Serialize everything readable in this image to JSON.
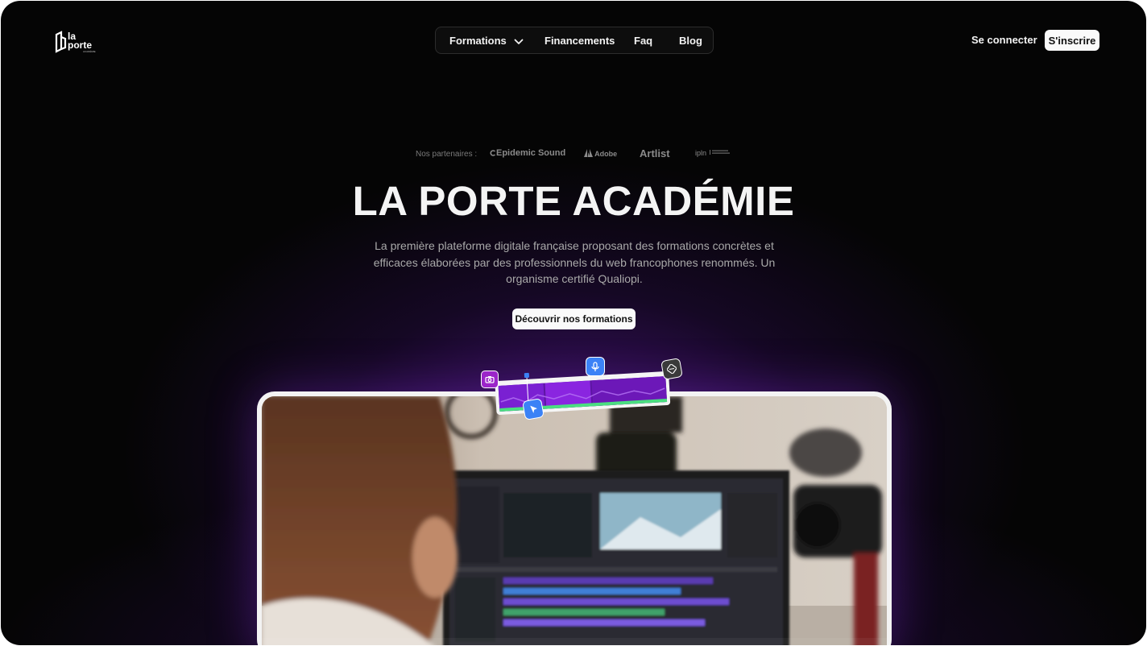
{
  "header": {
    "logo_top": "la",
    "logo_bottom": "porte",
    "logo_sub": "ACADÉMIE",
    "nav": [
      {
        "label": "Formations",
        "has_dropdown": true
      },
      {
        "label": "Financements"
      },
      {
        "label": "Faq"
      },
      {
        "label": "Blog"
      }
    ],
    "signin_label": "Se connecter",
    "signup_label": "S'inscrire"
  },
  "partners": {
    "label": "Nos partenaires :",
    "logos": [
      "Epidemic Sound",
      "Adobe",
      "Artlist",
      "ipln"
    ]
  },
  "hero": {
    "title": "LA PORTE ACADÉMIE",
    "description": "La première plateforme digitale française proposant des formations concrètes et efficaces élaborées par des professionnels du web francophones renommés. Un organisme certifié Qualiopi.",
    "cta_label": "Découvrir nos formations"
  },
  "colors": {
    "background": "#050505",
    "glow": "#7a20d2",
    "accent_purple": "#8a1fd0",
    "accent_blue": "#3b82f6",
    "timeline_green": "#4ade80"
  },
  "icons": [
    "chevron-down-icon",
    "camera-icon",
    "microphone-icon",
    "cursor-icon",
    "film-icon"
  ]
}
